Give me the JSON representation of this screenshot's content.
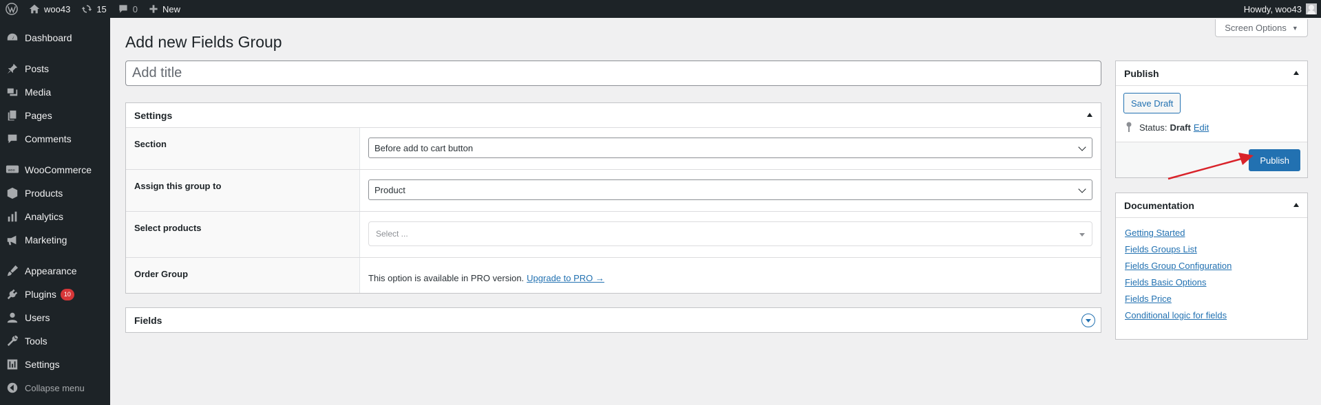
{
  "adminbar": {
    "site_name": "woo43",
    "updates_count": "15",
    "comments_count": "0",
    "new_label": "New",
    "howdy": "Howdy, woo43"
  },
  "sidebar": {
    "items": [
      {
        "label": "Dashboard",
        "icon": "dashboard-icon"
      },
      {
        "label": "Posts",
        "icon": "pin-icon"
      },
      {
        "label": "Media",
        "icon": "media-icon"
      },
      {
        "label": "Pages",
        "icon": "pages-icon"
      },
      {
        "label": "Comments",
        "icon": "comment-icon"
      },
      {
        "label": "WooCommerce",
        "icon": "woo-icon"
      },
      {
        "label": "Products",
        "icon": "box-icon"
      },
      {
        "label": "Analytics",
        "icon": "bar-chart-icon"
      },
      {
        "label": "Marketing",
        "icon": "megaphone-icon"
      },
      {
        "label": "Appearance",
        "icon": "brush-icon"
      },
      {
        "label": "Plugins",
        "icon": "plug-icon",
        "badge": "10"
      },
      {
        "label": "Users",
        "icon": "user-icon"
      },
      {
        "label": "Tools",
        "icon": "wrench-icon"
      },
      {
        "label": "Settings",
        "icon": "sliders-icon"
      }
    ],
    "collapse": "Collapse menu"
  },
  "screen_options": "Screen Options",
  "page_title": "Add new Fields Group",
  "title_input": {
    "placeholder": "Add title",
    "value": ""
  },
  "settings": {
    "heading": "Settings",
    "rows": [
      {
        "label": "Section",
        "value": "Before add to cart button"
      },
      {
        "label": "Assign this group to",
        "value": "Product"
      },
      {
        "label": "Select products",
        "placeholder": "Select ..."
      },
      {
        "label": "Order Group",
        "text": "This option is available in PRO version.",
        "link": "Upgrade to PRO →"
      }
    ]
  },
  "fields_box": {
    "heading": "Fields"
  },
  "publish": {
    "heading": "Publish",
    "save_draft": "Save Draft",
    "status_label": "Status:",
    "status_value": "Draft",
    "edit_link": "Edit",
    "publish_button": "Publish"
  },
  "documentation": {
    "heading": "Documentation",
    "links": [
      "Getting Started",
      "Fields Groups List",
      "Fields Group Configuration",
      "Fields Basic Options",
      "Fields Price",
      "Conditional logic for fields"
    ]
  },
  "colors": {
    "admin_bg": "#1d2327",
    "accent": "#2271b1",
    "badge": "#d63638",
    "annotation_arrow": "#d9232a"
  }
}
